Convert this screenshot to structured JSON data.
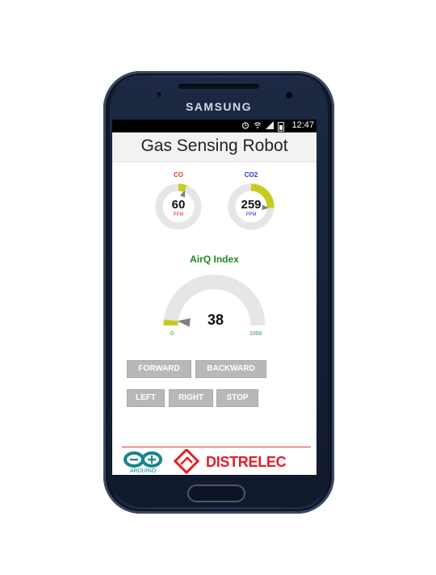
{
  "device": {
    "brand": "SAMSUNG"
  },
  "status_bar": {
    "time": "12:47",
    "icons": [
      "alarm-icon",
      "wifi-icon",
      "signal-icon",
      "battery-icon"
    ]
  },
  "app": {
    "title": "Gas Sensing Robot"
  },
  "gauges": [
    {
      "label": "CO",
      "value": "60",
      "unit": "PPM",
      "label_color": "#e53a3a",
      "unit_color": "#e53a3a",
      "fraction": 0.06
    },
    {
      "label": "CO2",
      "value": "259",
      "unit": "PPM",
      "label_color": "#2b2bd8",
      "unit_color": "#2b2bd8",
      "fraction": 0.26
    }
  ],
  "airq": {
    "title": "AirQ Index",
    "value": "38",
    "min": "0",
    "max": "1000",
    "fraction": 0.038
  },
  "controls": {
    "forward": "FORWARD",
    "backward": "BACKWARD",
    "left": "LEFT",
    "right": "RIGHT",
    "stop": "STOP"
  },
  "footer": {
    "arduino_text": "ARDUINO",
    "distrelec_text": "DISTRELEC"
  },
  "colors": {
    "accent_fill": "#c6cc1e",
    "track": "#e6e6e6",
    "brand_red": "#e41e26",
    "arduino_teal": "#17858c"
  }
}
